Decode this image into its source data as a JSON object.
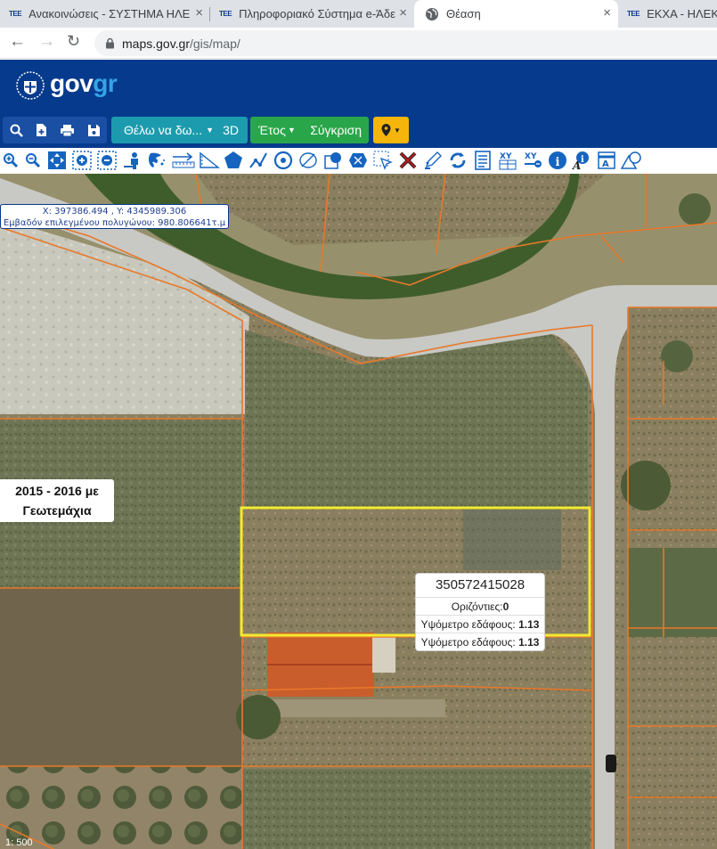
{
  "browser": {
    "tabs": [
      {
        "favicon": "ΤΕΕ",
        "title": "Ανακοινώσεις - ΣΥΣΤΗΜΑ ΗΛΕ",
        "close": "×"
      },
      {
        "favicon": "ΤΕΕ",
        "title": "Πληροφοριακό Σύστημα e-Άδει",
        "close": "×"
      },
      {
        "favicon": "globe-icon",
        "title": "Θέαση",
        "close": "×"
      },
      {
        "favicon": "ΤΕΕ",
        "title": "ΕΚΧΑ - ΗΛΕΚΤΡ",
        "close": ""
      }
    ],
    "url_host": "maps.gov.gr",
    "url_path": "/gis/map/"
  },
  "header": {
    "logo_gov": "gov",
    "logo_gr": "gr"
  },
  "toolbar": {
    "want_to_see": "Θέλω να δω...",
    "label_3d": "3D",
    "year": "Έτος",
    "compare": "Σύγκριση"
  },
  "map": {
    "coords_line": "X: 397386.494 , Y: 4345989.306",
    "area_line": "Εμβαδόν επιλεγμένου πολυγώνου: 980.806641τ.μ",
    "year_label_line1": "2015 - 2016 με",
    "year_label_line2": "Γεωτεμάχια",
    "parcel": {
      "id": "350572415028",
      "contours_label": "Οριζόντιες:",
      "contours_value": "0",
      "elevation_label": "Υψόμετρο εδάφους:",
      "elevation_value_1": "1.13",
      "elevation_value_2": "1.13"
    },
    "scale": "1: 500"
  },
  "colors": {
    "header_blue": "#063a8c",
    "btn_blue": "#1a4fa3",
    "btn_teal": "#1d9bae",
    "btn_green": "#2aa64a",
    "btn_yellow": "#f5b50a",
    "parcel_yellow": "#f2ea30",
    "boundary_orange": "#e8782a"
  }
}
